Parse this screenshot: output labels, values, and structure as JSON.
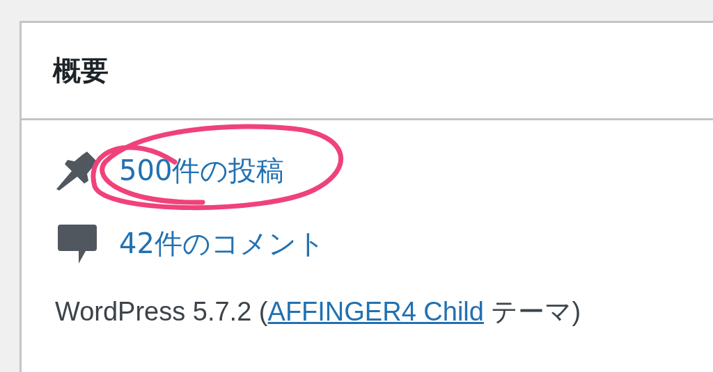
{
  "widget": {
    "title": "概要"
  },
  "items": [
    {
      "kind": "posts",
      "label": "500件の投稿"
    },
    {
      "kind": "comments",
      "label": "42件のコメント"
    }
  ],
  "footer": {
    "before": "WordPress 5.7.2 (",
    "link": "AFFINGER4 Child",
    "after": " テーマ)"
  }
}
